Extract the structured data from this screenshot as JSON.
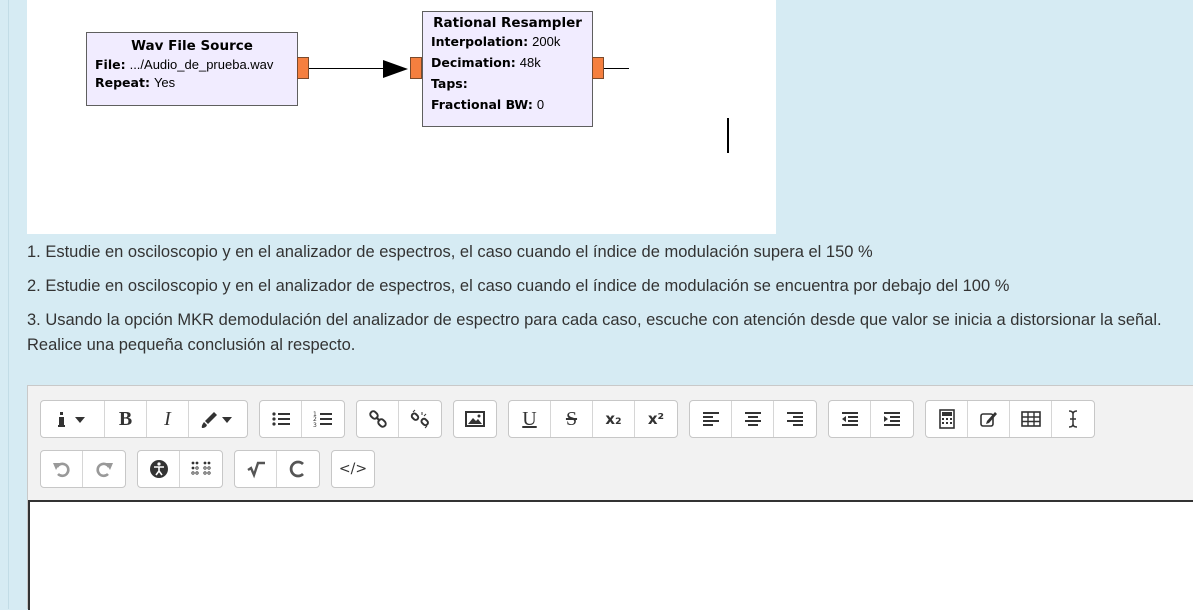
{
  "diagram": {
    "source_block": {
      "title": "Wav File Source",
      "params": [
        {
          "label": "File:",
          "value": ".../Audio_de_prueba.wav"
        },
        {
          "label": "Repeat:",
          "value": "Yes"
        }
      ]
    },
    "resampler_block": {
      "title": "Rational Resampler",
      "params": [
        {
          "label": "Interpolation:",
          "value": "200k"
        },
        {
          "label": "Decimation:",
          "value": "48k"
        },
        {
          "label": "Taps:",
          "value": ""
        },
        {
          "label": "Fractional BW:",
          "value": "0"
        }
      ]
    }
  },
  "steps": [
    "1. Estudie en osciloscopio y en el analizador de espectros, el caso cuando el índice de modulación supera el 150 %",
    "2. Estudie en osciloscopio y en el analizador de espectros, el caso cuando el índice de modulación se encuentra por debajo del 100 %",
    "3. Usando la opción MKR demodulación del analizador de espectro  para cada caso, escuche con atención desde que valor se inicia a distorsionar la señal. Realice una pequeña conclusión al respecto."
  ],
  "toolbar": {
    "bold_label": "B",
    "italic_label": "I",
    "underline_label": "U",
    "strike_label": "S",
    "subscript_label": "x₂",
    "superscript_label": "x²",
    "code_label": "</>"
  },
  "icons": [
    "info-icon",
    "bold-icon",
    "italic-icon",
    "brush-icon",
    "unordered-list-icon",
    "ordered-list-icon",
    "link-icon",
    "unlink-icon",
    "image-icon",
    "underline-icon",
    "strikethrough-icon",
    "subscript-icon",
    "superscript-icon",
    "align-left-icon",
    "align-center-icon",
    "align-right-icon",
    "outdent-icon",
    "indent-icon",
    "calculator-icon",
    "edit-icon",
    "table-icon",
    "text-cursor-icon",
    "undo-icon",
    "redo-icon",
    "accessibility-icon",
    "braille-icon",
    "square-root-icon",
    "chemistry-icon",
    "html-code-icon"
  ],
  "colors": {
    "page_background": "#d6ebf3",
    "block_fill": "#f1ecff",
    "port_orange": "#f57f3f"
  }
}
